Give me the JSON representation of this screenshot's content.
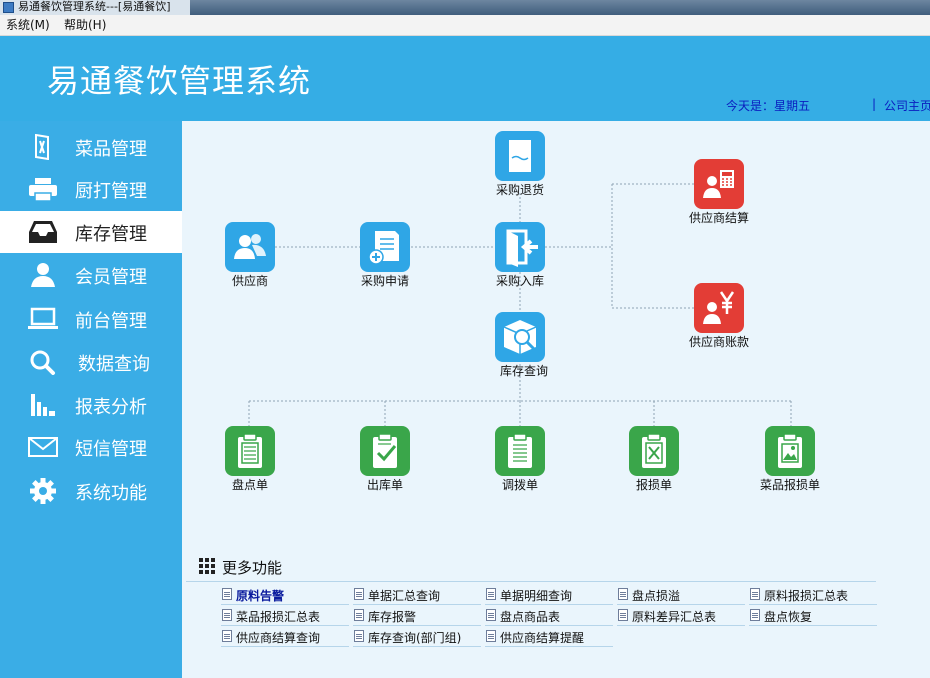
{
  "window": {
    "title": "易通餐饮管理系统---[易通餐饮]"
  },
  "menu": {
    "items": [
      "系统(M)",
      "帮助(H)"
    ]
  },
  "header": {
    "app_title": "易通餐饮管理系统",
    "today_label": "今天是：星期五",
    "separator": "|",
    "home_link": "公司主页"
  },
  "sidebar": {
    "items": [
      {
        "label": "菜品管理",
        "icon": "menu-knife-icon"
      },
      {
        "label": "厨打管理",
        "icon": "printer-icon"
      },
      {
        "label": "库存管理",
        "icon": "inbox-tray-icon",
        "active": true
      },
      {
        "label": "会员管理",
        "icon": "person-icon"
      },
      {
        "label": "前台管理",
        "icon": "laptop-icon"
      },
      {
        "label": "数据查询",
        "icon": "search-icon"
      },
      {
        "label": "报表分析",
        "icon": "bar-chart-icon"
      },
      {
        "label": "短信管理",
        "icon": "envelope-icon"
      },
      {
        "label": "系统功能",
        "icon": "gear-icon"
      }
    ]
  },
  "flow": {
    "nodes": {
      "purchase_return": "采购退货",
      "supplier": "供应商",
      "purchase_request": "采购申请",
      "purchase_in": "采购入库",
      "supplier_settlement": "供应商结算",
      "supplier_account": "供应商账款",
      "stock_query": "库存查询",
      "inventory_sheet": "盘点单",
      "outbound_sheet": "出库单",
      "transfer_sheet": "调拨单",
      "loss_sheet": "报损单",
      "dish_loss_sheet": "菜品报损单"
    },
    "colors": {
      "blue": "#2fa6e6",
      "red": "#e33d36",
      "green": "#3aa64a"
    }
  },
  "more": {
    "title": "更多功能",
    "links": [
      "原料告警",
      "单据汇总查询",
      "单据明细查询",
      "盘点损溢",
      "原料报损汇总表",
      "菜品报损汇总表",
      "库存报警",
      "盘点商品表",
      "原料差异汇总表",
      "盘点恢复",
      "供应商结算查询",
      "库存查询(部门组)",
      "供应商结算提醒"
    ]
  }
}
